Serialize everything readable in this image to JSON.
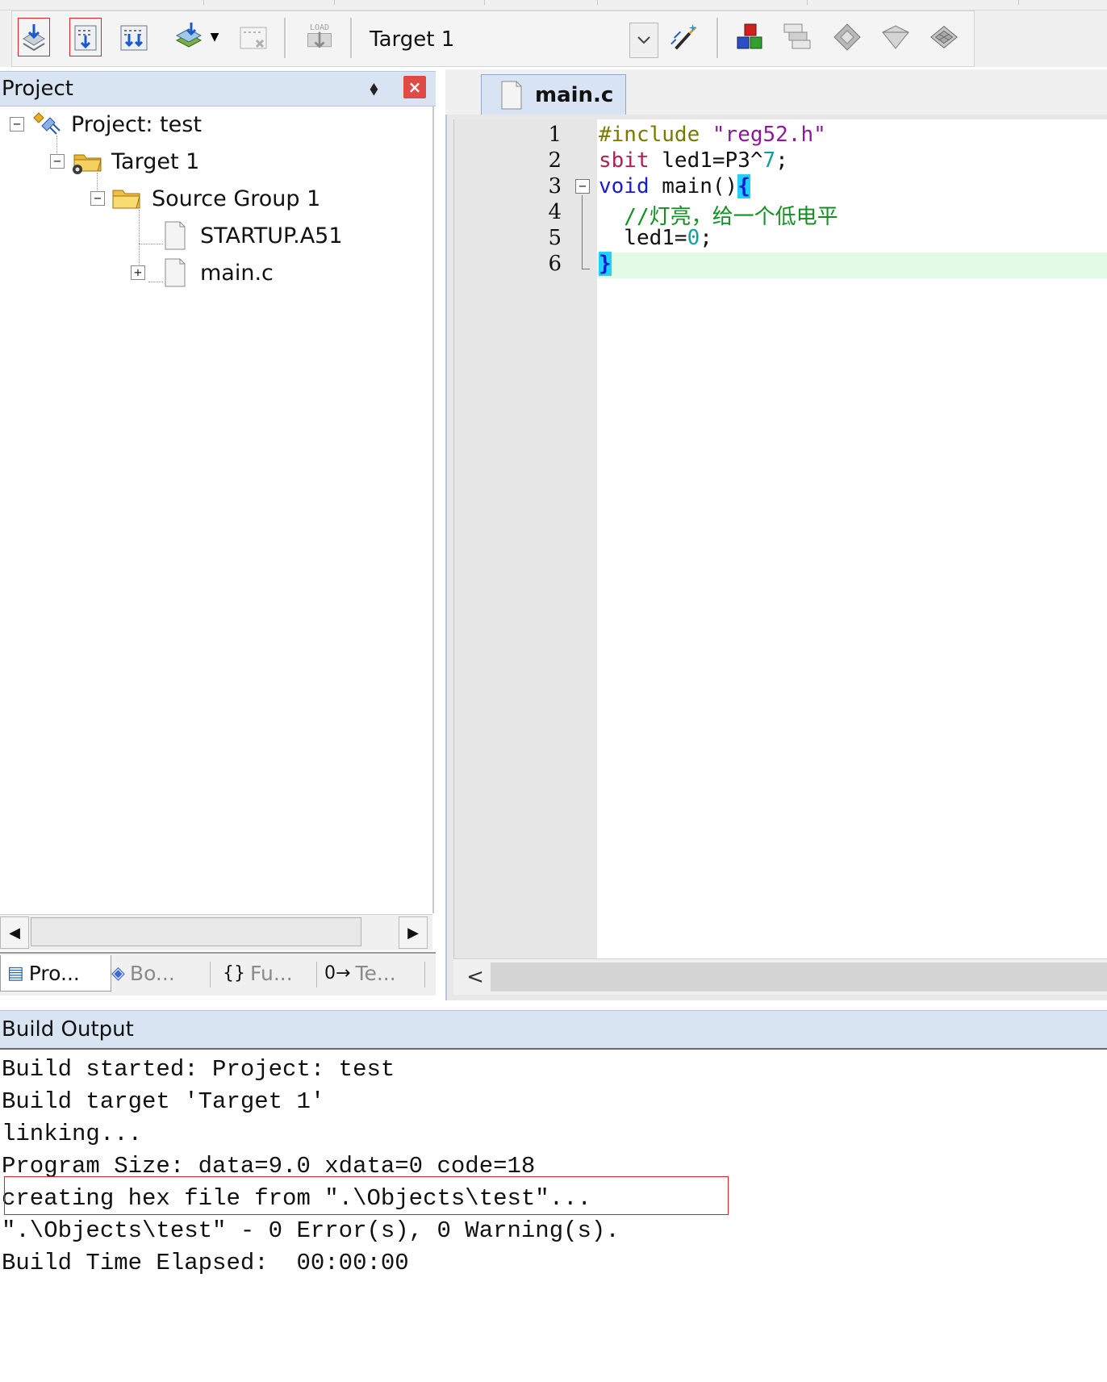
{
  "toolbar": {
    "buttons": [
      {
        "name": "translate-icon",
        "highlighted": true
      },
      {
        "name": "build-icon",
        "highlighted": true
      },
      {
        "name": "rebuild-icon",
        "highlighted": false
      },
      {
        "name": "batch-build-icon",
        "highlighted": false
      },
      {
        "name": "stop-build-icon",
        "highlighted": false
      },
      {
        "name": "download-icon",
        "highlighted": false
      }
    ],
    "load_label": "LOAD",
    "target": "Target 1",
    "right_buttons": [
      "target-options-icon",
      "manage-components-icon",
      "pack-installer-icon",
      "select-packs-icon",
      "manage-rte-icon",
      "run-time-env-icon"
    ]
  },
  "project_panel": {
    "title": "Project",
    "pin_glyph": "⬧",
    "close_glyph": "×",
    "tree": {
      "project": "Project: test",
      "target": "Target 1",
      "group": "Source Group 1",
      "files": [
        "STARTUP.A51",
        "main.c"
      ]
    },
    "tabs": [
      {
        "label": "Pro...",
        "icon": "▤"
      },
      {
        "label": "Bo...",
        "icon": "◈"
      },
      {
        "label": "Fu...",
        "icon": "{}"
      },
      {
        "label": "Te...",
        "icon": "0→"
      }
    ]
  },
  "editor": {
    "tab": "main.c",
    "line_numbers": [
      "1",
      "2",
      "3",
      "4",
      "5",
      "6"
    ],
    "code": {
      "l1_pp": "#include ",
      "l1_str": "\"reg52.h\"",
      "l2_kw": "sbit",
      "l2_mid": " led1=P3^",
      "l2_num": "7",
      "l2_end": ";",
      "l3_kw": "void",
      "l3_mid": " main()",
      "l3_brace": "{",
      "l4_cmt": "  //灯亮，给一个低电平",
      "l5_mid": "  led1=",
      "l5_num": "0",
      "l5_end": ";",
      "l6_brace": "}"
    },
    "scroll_left": "<"
  },
  "build_output": {
    "title": "Build Output",
    "lines": [
      "Build started: Project: test",
      "Build target 'Target 1'",
      "linking...",
      "Program Size: data=9.0 xdata=0 code=18",
      "creating hex file from \".\\Objects\\test\"...",
      "\".\\Objects\\test\" - 0 Error(s), 0 Warning(s).",
      "Build Time Elapsed:  00:00:00"
    ]
  },
  "colors": {
    "highlight_box": "#e0202a",
    "panel_header": "#d8e4f2",
    "current_line": "#e2fbe6",
    "brace_match": "#20d0ff"
  }
}
